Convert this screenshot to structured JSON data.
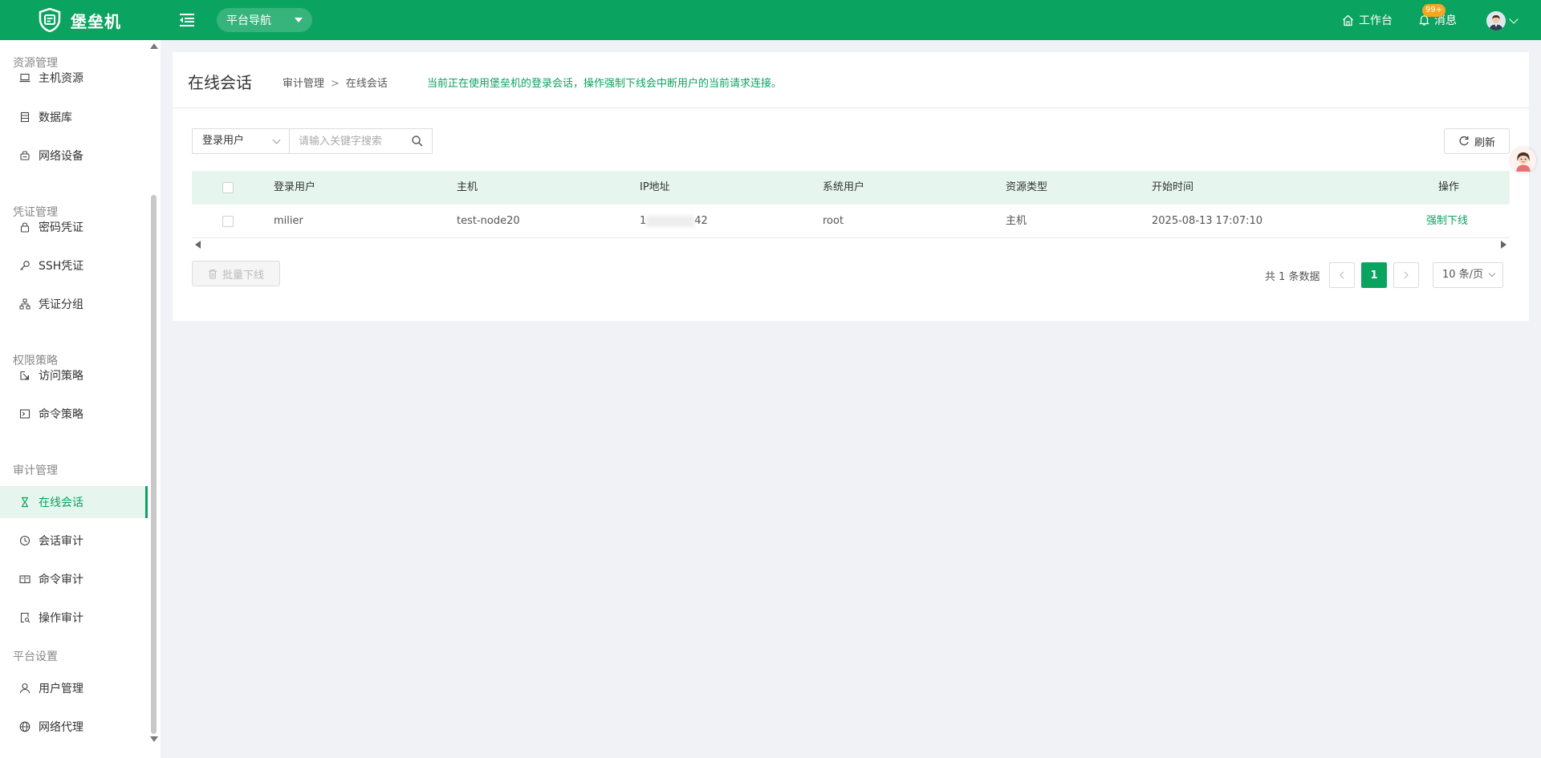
{
  "app": {
    "title": "堡垒机"
  },
  "topbar": {
    "nav_select": "平台导航",
    "workbench": "工作台",
    "messages": "消息",
    "message_badge": "99+"
  },
  "sidebar": {
    "groups": [
      {
        "title": "资源管理",
        "items": [
          "主机资源",
          "数据库",
          "网络设备"
        ]
      },
      {
        "title": "凭证管理",
        "items": [
          "密码凭证",
          "SSH凭证",
          "凭证分组"
        ]
      },
      {
        "title": "权限策略",
        "items": [
          "访问策略",
          "命令策略"
        ]
      },
      {
        "title": "审计管理",
        "items": [
          "在线会话",
          "会话审计",
          "命令审计",
          "操作审计"
        ]
      },
      {
        "title": "平台设置",
        "items": [
          "用户管理",
          "网络代理"
        ]
      }
    ],
    "active_item": "在线会话"
  },
  "page": {
    "title": "在线会话",
    "breadcrumb": [
      "审计管理",
      "在线会话"
    ],
    "breadcrumb_sep": ">",
    "tip": "当前正在使用堡垒机的登录会话，操作强制下线会中断用户的当前请求连接。"
  },
  "filter": {
    "field": "登录用户",
    "placeholder": "请输入关键字搜索",
    "refresh": "刷新"
  },
  "table": {
    "columns": [
      "登录用户",
      "主机",
      "IP地址",
      "系统用户",
      "资源类型",
      "开始时间",
      "操作"
    ],
    "rows": [
      {
        "login_user": "milier",
        "host": "test-node20",
        "ip_prefix": "1",
        "ip_suffix": "42",
        "system_user": "root",
        "resource_type": "主机",
        "start_time": "2025-08-13 17:07:10",
        "action": "强制下线"
      }
    ]
  },
  "footer": {
    "batch_offline": "批量下线",
    "total": "共 1 条数据",
    "current_page": "1",
    "page_size": "10 条/页"
  },
  "colors": {
    "primary": "#0ba360",
    "badge": "#f5a623"
  }
}
